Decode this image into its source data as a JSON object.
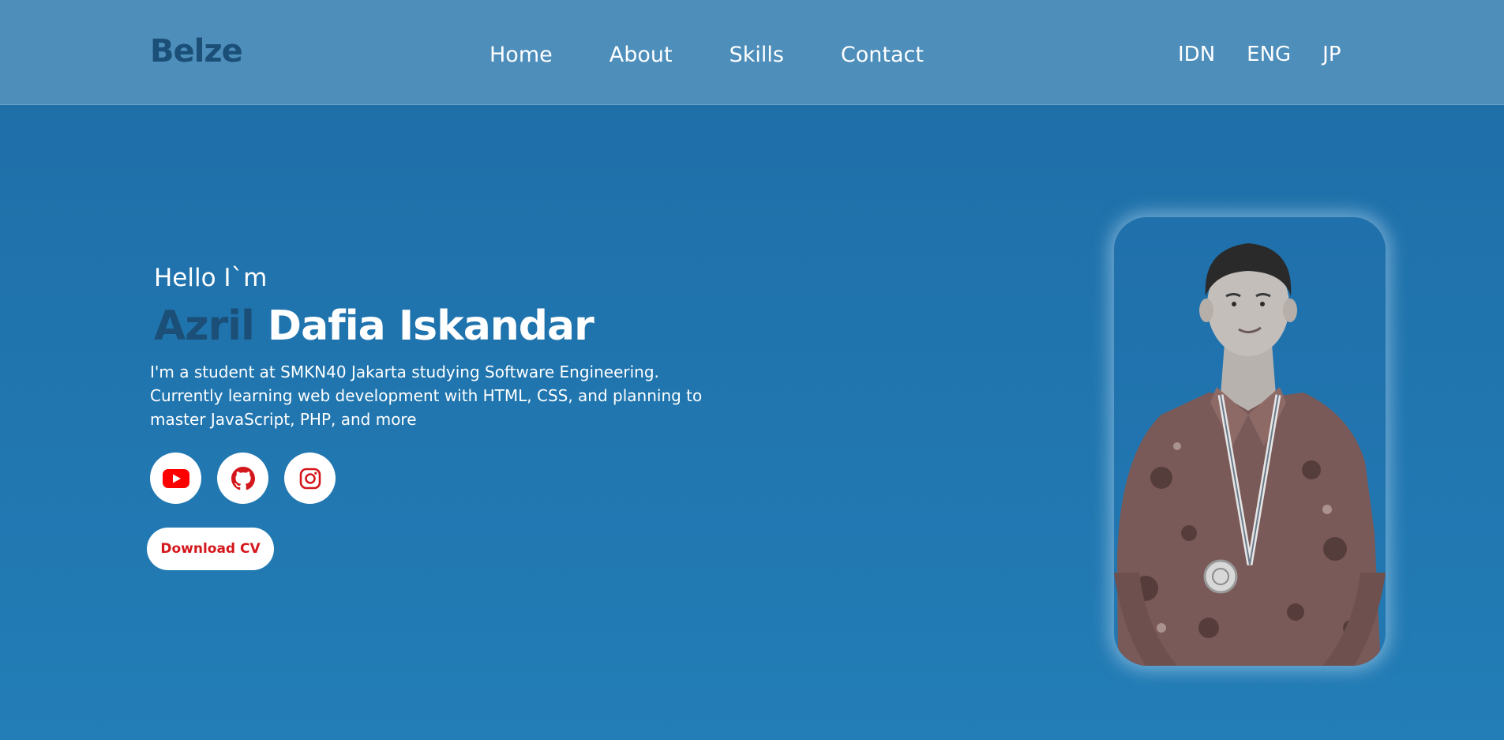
{
  "header": {
    "brand": "Belze",
    "nav": [
      "Home",
      "About",
      "Skills",
      "Contact"
    ],
    "languages": [
      "IDN",
      "ENG",
      "JP"
    ]
  },
  "hero": {
    "greeting": "Hello I`m",
    "name_first": "Azril",
    "name_rest": "Dafia Iskandar",
    "bio_lines": [
      "I'm a student at SMKN40 Jakarta studying Software Engineering.",
      "Currently learning web development with HTML, CSS, and planning to",
      "master JavaScript, PHP, and more"
    ],
    "socials": [
      {
        "icon": "youtube-icon",
        "color": "#ff0000"
      },
      {
        "icon": "github-icon",
        "color": "#d4171c"
      },
      {
        "icon": "instagram-icon",
        "color": "#d4171c"
      }
    ],
    "download_label": "Download CV",
    "photo": {
      "icon": "profile-photo"
    }
  },
  "colors": {
    "background": "#1e6da7",
    "navbar": "#4d8ebb",
    "brand": "#1b4f77",
    "accent": "#d4171c"
  }
}
